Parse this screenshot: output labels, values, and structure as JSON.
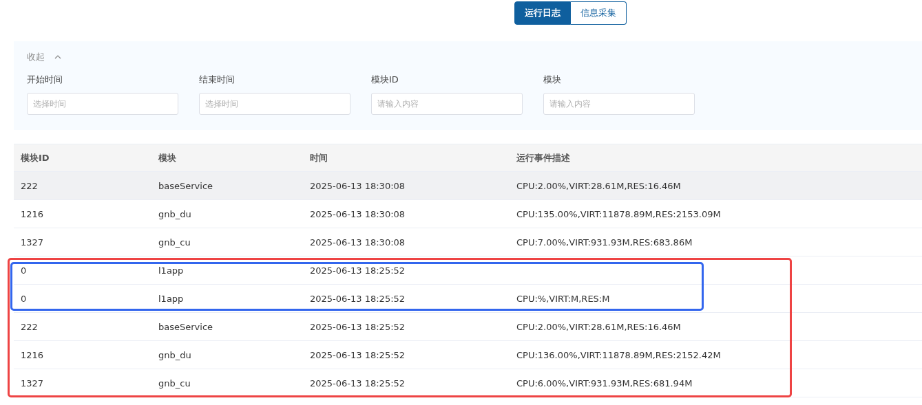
{
  "tabs": [
    {
      "label": "运行日志",
      "selected": true
    },
    {
      "label": "信息采集",
      "selected": false
    }
  ],
  "filter": {
    "toggle": "收起",
    "expanded": true,
    "fields": [
      {
        "label": "开始时间",
        "placeholder": "选择时间"
      },
      {
        "label": "结束时间",
        "placeholder": "选择时间"
      },
      {
        "label": "模块ID",
        "placeholder": "请输入内容"
      },
      {
        "label": "模块",
        "placeholder": "请输入内容"
      }
    ]
  },
  "table": {
    "columns": [
      "模块ID",
      "模块",
      "时间",
      "运行事件描述"
    ],
    "rows": [
      {
        "highlighted": true,
        "cells": [
          "222",
          "baseService",
          "2025-06-13 18:30:08",
          "CPU:2.00%,VIRT:28.61M,RES:16.46M"
        ]
      },
      {
        "highlighted": false,
        "cells": [
          "1216",
          "gnb_du",
          "2025-06-13 18:30:08",
          "CPU:135.00%,VIRT:11878.89M,RES:2153.09M"
        ]
      },
      {
        "highlighted": false,
        "cells": [
          "1327",
          "gnb_cu",
          "2025-06-13 18:30:08",
          "CPU:7.00%,VIRT:931.93M,RES:683.86M"
        ]
      },
      {
        "highlighted": false,
        "cells": [
          "0",
          "l1app",
          "2025-06-13 18:25:52",
          ""
        ]
      },
      {
        "highlighted": false,
        "cells": [
          "0",
          "l1app",
          "2025-06-13 18:25:52",
          "CPU:%,VIRT:M,RES:M"
        ]
      },
      {
        "highlighted": false,
        "cells": [
          "222",
          "baseService",
          "2025-06-13 18:25:52",
          "CPU:2.00%,VIRT:28.61M,RES:16.46M"
        ]
      },
      {
        "highlighted": false,
        "cells": [
          "1216",
          "gnb_du",
          "2025-06-13 18:25:52",
          "CPU:136.00%,VIRT:11878.89M,RES:2152.42M"
        ]
      },
      {
        "highlighted": false,
        "cells": [
          "1327",
          "gnb_cu",
          "2025-06-13 18:25:52",
          "CPU:6.00%,VIRT:931.93M,RES:681.94M"
        ]
      }
    ]
  },
  "annotations": [
    {
      "kind": "outer",
      "color": "#ee4444"
    },
    {
      "kind": "inner",
      "color": "#3366ee"
    }
  ]
}
